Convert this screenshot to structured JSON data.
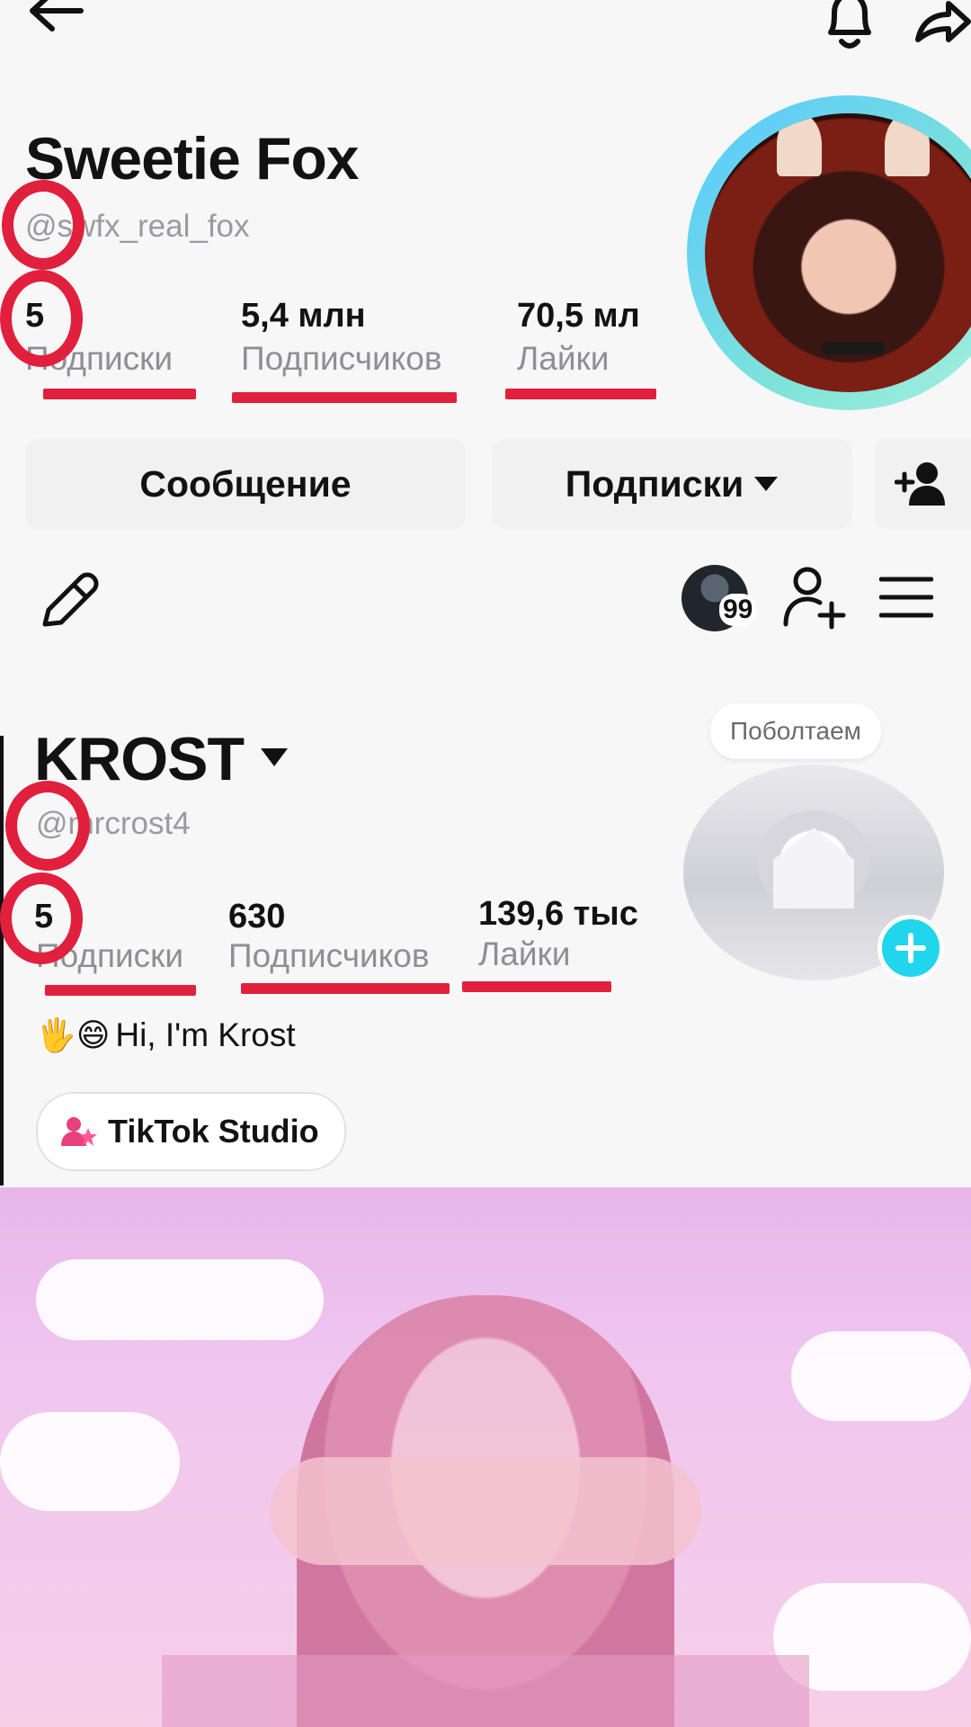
{
  "top_profile": {
    "name": "Sweetie Fox",
    "handle": "@swfx_real_fox",
    "stats": [
      {
        "value": "5",
        "label": "Подписки"
      },
      {
        "value": "5,4 млн",
        "label": "Подписчиков"
      },
      {
        "value": "70,5 мл",
        "label": "Лайки"
      }
    ],
    "message_button": "Сообщение",
    "following_button": "Подписки"
  },
  "own_profile": {
    "name": "KROST",
    "handle": "@mrcrost4",
    "inbox_badge": "99",
    "bubble": "Поболтаем",
    "stats": [
      {
        "value": "5",
        "label": "Подписки"
      },
      {
        "value": "630",
        "label": "Подписчиков"
      },
      {
        "value": "139,6 тыс",
        "label": "Лайки"
      }
    ],
    "bio_emoji": "🖐😄",
    "bio": "Hi, I'm Krost",
    "studio_button": "TikTok Studio"
  },
  "colors": {
    "annotation_red": "#e0203c",
    "plus_badge": "#20d5ec",
    "avatar_ring": "#56c8ff"
  },
  "icons": [
    "back-arrow-icon",
    "bell-icon",
    "share-icon",
    "add-user-icon",
    "pencil-icon",
    "menu-icon",
    "plus-icon",
    "studio-icon",
    "chevron-down-icon"
  ]
}
